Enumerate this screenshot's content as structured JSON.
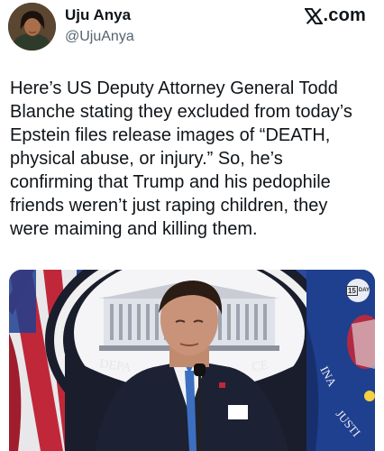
{
  "author": {
    "display_name": "Uju Anya",
    "handle": "@UjuAnya",
    "avatar_icon": "profile-photo"
  },
  "brand": {
    "logo_text": ".com",
    "logo_icon": "x-logo"
  },
  "tweet": {
    "lines": [
      "Here’s US Deputy Attorney General Todd",
      "Blanche stating they excluded from today’s",
      "Epstein files release images of “DEATH,",
      "physical abuse, or injury.” So, he’s",
      "confirming that Trump and his pedophile",
      "friends weren’t just raping children, they",
      "were maiming and killing them."
    ]
  },
  "media": {
    "seal_text_left": "DEPA",
    "seal_text_right": "CE",
    "flag_text_1": "INA",
    "flag_text_2": "JUSTI",
    "badge_text": "DAY",
    "badge_number": "15",
    "colors": {
      "backdrop": "#2d4a9a",
      "flag_blue": "#1f3f8f",
      "suit": "#1c2233"
    }
  }
}
